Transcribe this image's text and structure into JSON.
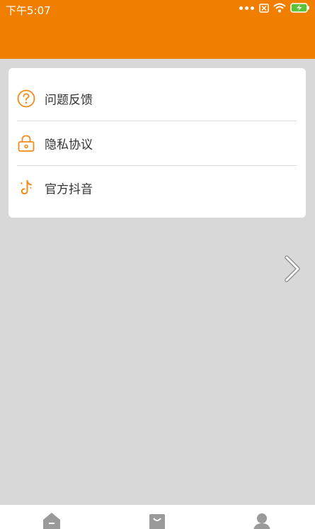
{
  "status_bar": {
    "time": "下午5:07",
    "icons": [
      "more-dots-icon",
      "sim-none-icon",
      "wifi-icon",
      "battery-charging-icon"
    ]
  },
  "theme": {
    "accent": "#f07f00",
    "background": "#d8d8d8",
    "card": "#ffffff",
    "text": "#333333",
    "divider": "#dcdcdc"
  },
  "menu": {
    "items": [
      {
        "label": "问题反馈",
        "icon": "question-circle-icon"
      },
      {
        "label": "隐私协议",
        "icon": "lock-icon"
      },
      {
        "label": "官方抖音",
        "icon": "tiktok-icon"
      }
    ]
  },
  "navigation": {
    "next_icon": "chevron-right-icon"
  },
  "bottom_tabs": [
    {
      "icon": "home-icon"
    },
    {
      "icon": "shopping-bag-icon"
    },
    {
      "icon": "user-icon"
    }
  ]
}
